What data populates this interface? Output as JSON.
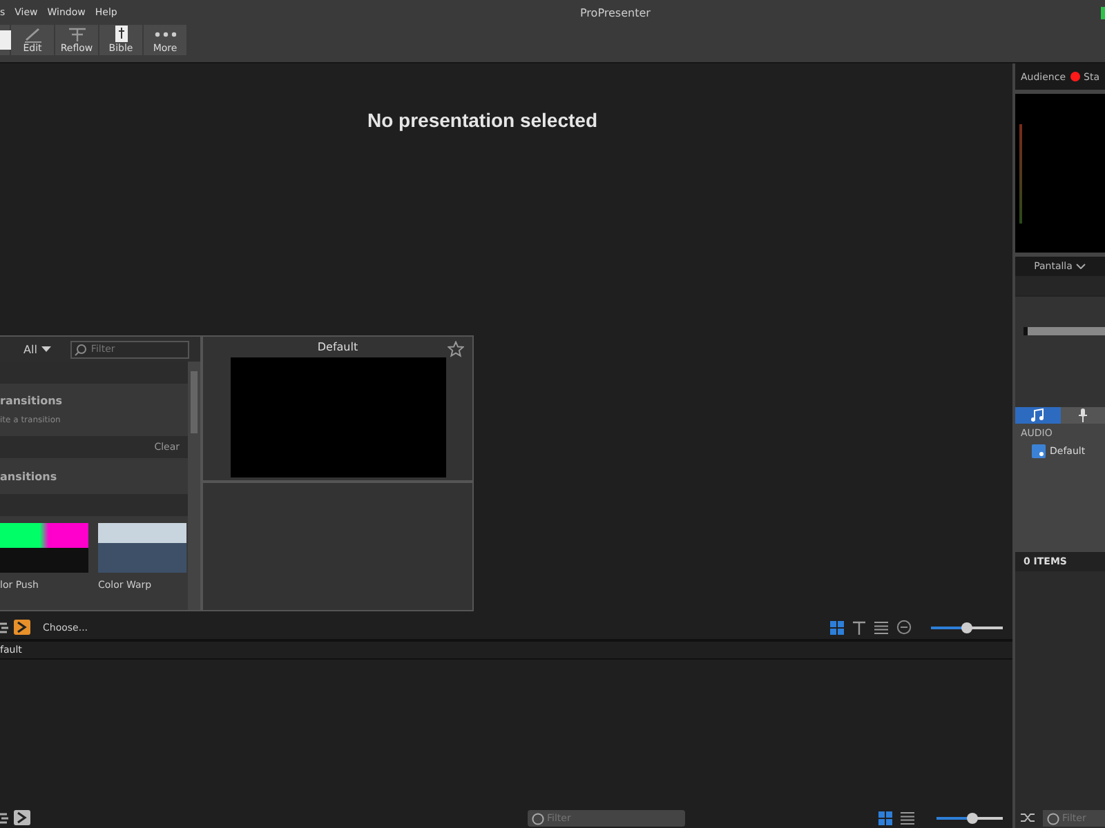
{
  "menu_bar": {
    "items": [
      "s",
      "View",
      "Window",
      "Help"
    ],
    "title": "ProPresenter"
  },
  "toolbar": {
    "buttons": [
      {
        "kind": "blank"
      },
      {
        "kind": "edit",
        "label": "Edit"
      },
      {
        "kind": "reflow",
        "label": "Reflow"
      },
      {
        "kind": "bible",
        "label": "Bible"
      },
      {
        "kind": "more",
        "label": "More"
      }
    ]
  },
  "main": {
    "message": "No presentation selected"
  },
  "transitions_popup": {
    "filter_dropdown": "All",
    "search": {
      "placeholder": "Filter"
    },
    "sections": [
      {
        "kind": "band"
      },
      {
        "kind": "heading",
        "text": "ransitions",
        "note": "ite a transition"
      },
      {
        "kind": "band",
        "text": "Clear"
      },
      {
        "kind": "heading",
        "text": "ansitions"
      },
      {
        "kind": "band"
      }
    ],
    "thumbnails": [
      {
        "kind": "colors",
        "label": "lor Push"
      },
      {
        "kind": "photo",
        "label": "Color Warp"
      }
    ],
    "preview": {
      "title": "Default"
    }
  },
  "bottom_toolbar": {
    "choose": "Choose...",
    "view_modes": [
      {
        "kind": "grid",
        "selected": true
      },
      {
        "kind": "text",
        "selected": false
      },
      {
        "kind": "list",
        "selected": false
      }
    ],
    "zoom": {
      "level": 0.5
    }
  },
  "library": {
    "header": "fault"
  },
  "status_bar": {
    "search": {
      "placeholder": "Filter"
    },
    "view_modes": [
      {
        "kind": "grid",
        "selected": true
      },
      {
        "kind": "list",
        "selected": false
      }
    ],
    "zoom": {
      "level": 0.55
    }
  },
  "right_panel": {
    "tabs": [
      {
        "label": "Audience",
        "live": true
      },
      {
        "label": "Sta",
        "live": false
      }
    ],
    "screen_dropdown": "Pantalla",
    "media_tabs": [
      {
        "kind": "music",
        "selected": true
      },
      {
        "kind": "mic",
        "selected": false
      }
    ],
    "section": "AUDIO",
    "items": [
      "Default"
    ],
    "count": "0 ITEMS",
    "search": {
      "placeholder": "Filter"
    }
  }
}
